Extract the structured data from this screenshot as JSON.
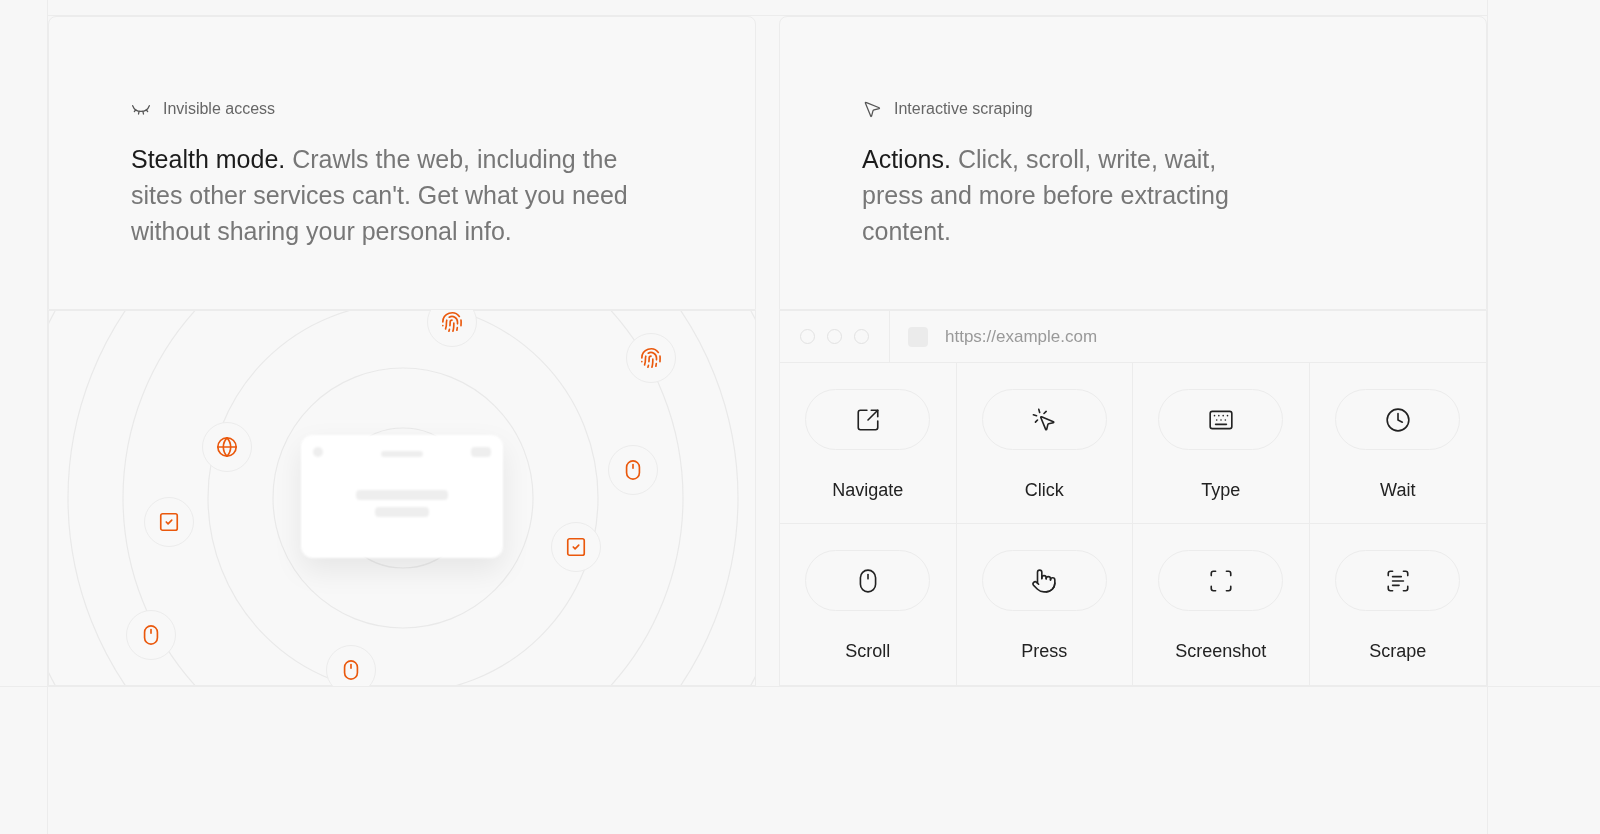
{
  "features": [
    {
      "eyebrow": "Invisible access",
      "headline": "**Stealth mode.** Crawls the web, including the sites other services can't. Get what you need without sharing your personal info."
    },
    {
      "eyebrow": "Interactive scraping",
      "headline": "**Actions.** Click, scroll, write, wait, press and more before extracting content."
    }
  ],
  "browser": {
    "url": "https://example.com"
  },
  "actions": [
    {
      "kind": "navigate",
      "label": "Navigate"
    },
    {
      "kind": "click",
      "label": "Click"
    },
    {
      "kind": "type",
      "label": "Type"
    },
    {
      "kind": "wait",
      "label": "Wait"
    },
    {
      "kind": "scroll",
      "label": "Scroll"
    },
    {
      "kind": "press",
      "label": "Press"
    },
    {
      "kind": "screenshot",
      "label": "Screenshot"
    },
    {
      "kind": "scrape",
      "label": "Scrape"
    }
  ]
}
